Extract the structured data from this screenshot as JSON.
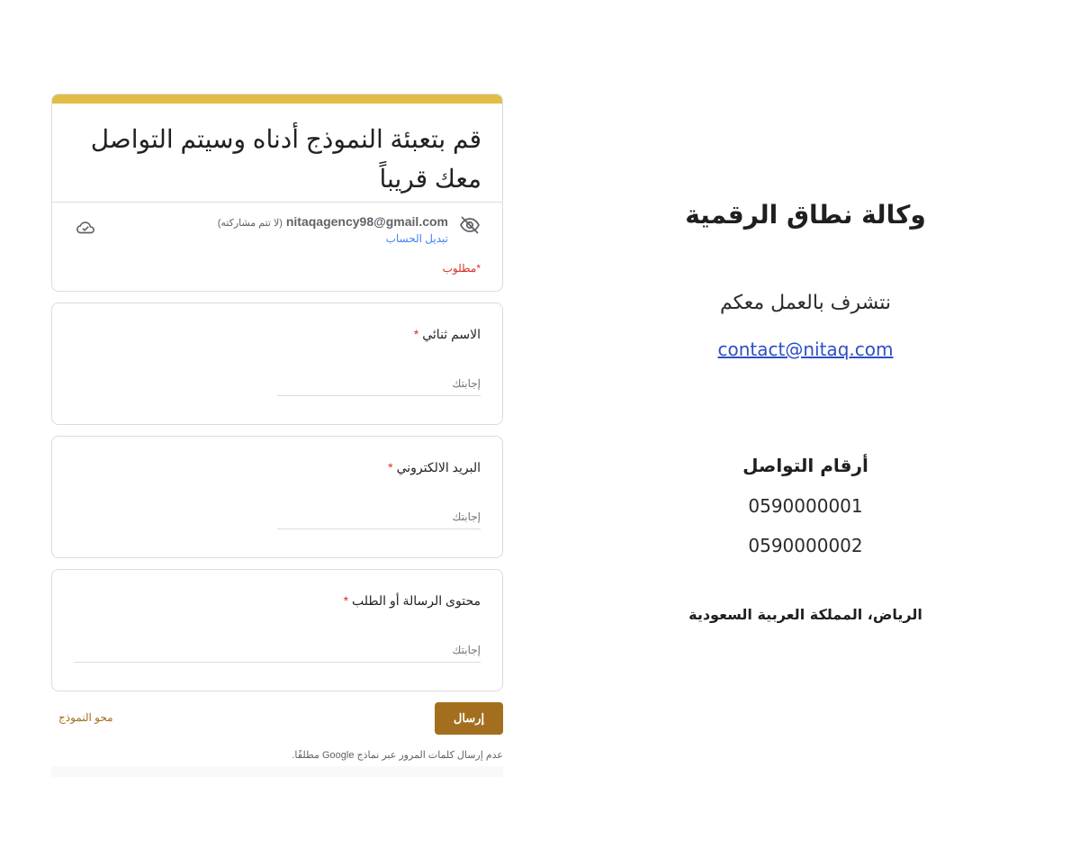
{
  "form": {
    "title": "قم بتعبئة النموذج أدناه وسيتم التواصل معك قريباً",
    "account": {
      "email": "nitaqagency98@gmail.com",
      "not_shared": "(لا تتم مشاركته)",
      "switch_account": "تبديل الحساب"
    },
    "required_note": "*مطلوب",
    "questions": [
      {
        "label": "الاسم ثنائي",
        "required_mark": "*",
        "placeholder": "إجابتك"
      },
      {
        "label": "البريد الالكتروني",
        "required_mark": "*",
        "placeholder": "إجابتك"
      },
      {
        "label": "محتوى الرسالة أو الطلب",
        "required_mark": "*",
        "placeholder": "إجابتك"
      }
    ],
    "submit_label": "إرسال",
    "clear_label": "محو النموذج",
    "password_note": "عدم إرسال كلمات المرور عبر نماذج Google مطلقًا."
  },
  "info": {
    "agency_name": "وكالة نطاق الرقمية",
    "tagline": "نتشرف بالعمل معكم",
    "contact_email": "contact@nitaq.com",
    "phones_title": "أرقام التواصل",
    "phones": [
      "0590000001",
      "0590000002"
    ],
    "location": "الرياض، المملكة العربية السعودية"
  },
  "colors": {
    "accent": "#e2bd45",
    "button": "#a36f1f",
    "required": "#d93025",
    "link": "#2d4fc4"
  },
  "icons": {
    "visibility": "eye-off-icon",
    "cloud": "cloud-done-icon"
  }
}
